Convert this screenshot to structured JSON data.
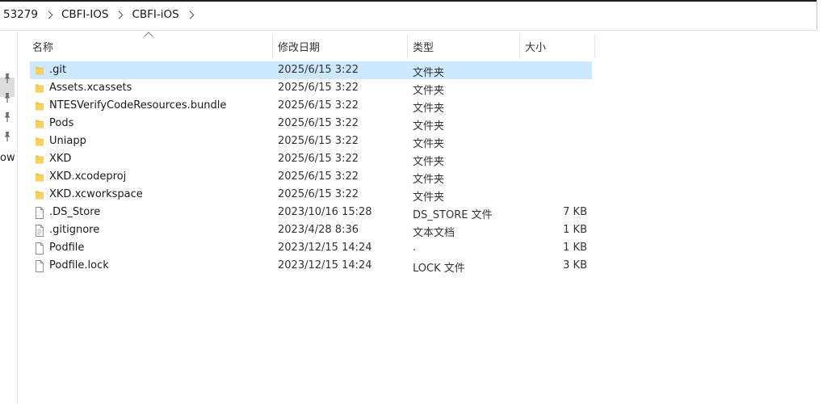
{
  "breadcrumb": [
    "53279",
    "CBFI-IOS",
    "CBFI-iOS"
  ],
  "nav": {
    "cut_label": "ow"
  },
  "columns": {
    "name": "名称",
    "date": "修改日期",
    "type": "类型",
    "size": "大小"
  },
  "files": [
    {
      "name": ".git",
      "date": "2025/6/15 3:22",
      "type": "文件夹",
      "size": "",
      "kind": "folder",
      "selected": true
    },
    {
      "name": "Assets.xcassets",
      "date": "2025/6/15 3:22",
      "type": "文件夹",
      "size": "",
      "kind": "folder"
    },
    {
      "name": "NTESVerifyCodeResources.bundle",
      "date": "2025/6/15 3:22",
      "type": "文件夹",
      "size": "",
      "kind": "folder"
    },
    {
      "name": "Pods",
      "date": "2025/6/15 3:22",
      "type": "文件夹",
      "size": "",
      "kind": "folder"
    },
    {
      "name": "Uniapp",
      "date": "2025/6/15 3:22",
      "type": "文件夹",
      "size": "",
      "kind": "folder"
    },
    {
      "name": "XKD",
      "date": "2025/6/15 3:22",
      "type": "文件夹",
      "size": "",
      "kind": "folder"
    },
    {
      "name": "XKD.xcodeproj",
      "date": "2025/6/15 3:22",
      "type": "文件夹",
      "size": "",
      "kind": "folder"
    },
    {
      "name": "XKD.xcworkspace",
      "date": "2025/6/15 3:22",
      "type": "文件夹",
      "size": "",
      "kind": "folder"
    },
    {
      "name": ".DS_Store",
      "date": "2023/10/16 15:28",
      "type": "DS_STORE 文件",
      "size": "7 KB",
      "kind": "file"
    },
    {
      "name": ".gitignore",
      "date": "2023/4/28 8:36",
      "type": "文本文档",
      "size": "1 KB",
      "kind": "text-file"
    },
    {
      "name": "Podfile",
      "date": "2023/12/15 14:24",
      "type": ".",
      "size": "1 KB",
      "kind": "blank-file"
    },
    {
      "name": "Podfile.lock",
      "date": "2023/12/15 14:24",
      "type": "LOCK 文件",
      "size": "3 KB",
      "kind": "blank-file"
    }
  ],
  "colors": {
    "selection": "#cce8ff",
    "folder": "#f5c242"
  }
}
